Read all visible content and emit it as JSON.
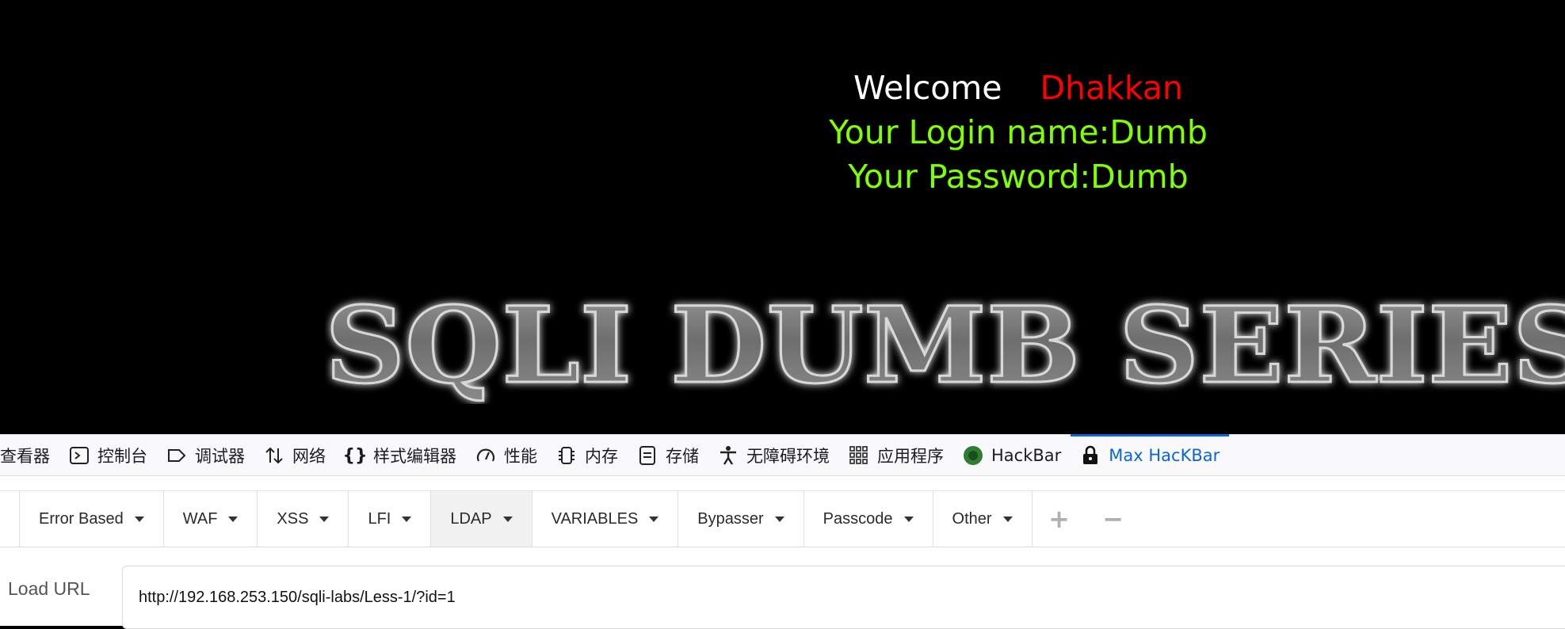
{
  "page": {
    "welcome_word": "Welcome",
    "welcome_name": "Dhakkan",
    "login_line": "Your Login name:Dumb",
    "password_line": "Your Password:Dumb",
    "banner_text": "SQLI DUMB SERIES",
    "colors": {
      "background": "#000000",
      "welcome": "#ffffff",
      "name": "#ff0000",
      "info": "#7fff00"
    }
  },
  "devtools": {
    "tabs": [
      {
        "label": "查看器",
        "icon": "inspector-icon"
      },
      {
        "label": "控制台",
        "icon": "console-icon"
      },
      {
        "label": "调试器",
        "icon": "debugger-icon"
      },
      {
        "label": "网络",
        "icon": "network-icon"
      },
      {
        "label": "样式编辑器",
        "icon": "style-editor-icon"
      },
      {
        "label": "性能",
        "icon": "performance-icon"
      },
      {
        "label": "内存",
        "icon": "memory-icon"
      },
      {
        "label": "存储",
        "icon": "storage-icon"
      },
      {
        "label": "无障碍环境",
        "icon": "accessibility-icon"
      },
      {
        "label": "应用程序",
        "icon": "application-icon"
      },
      {
        "label": "HackBar",
        "icon": "hackbar-icon"
      },
      {
        "label": "Max HacKBar",
        "icon": "max-hackbar-icon",
        "active": true
      }
    ],
    "active_color": "#0a66d8"
  },
  "hackbar": {
    "menu": [
      {
        "label": "Error Based"
      },
      {
        "label": "WAF"
      },
      {
        "label": "XSS"
      },
      {
        "label": "LFI"
      },
      {
        "label": "LDAP"
      },
      {
        "label": "VARIABLES"
      },
      {
        "label": "Bypasser"
      },
      {
        "label": "Passcode"
      },
      {
        "label": "Other"
      }
    ],
    "plus_label": "+",
    "minus_label": "−",
    "load_url_label": "Load URL",
    "url_value": "http://192.168.253.150/sqli-labs/Less-1/?id=1"
  }
}
